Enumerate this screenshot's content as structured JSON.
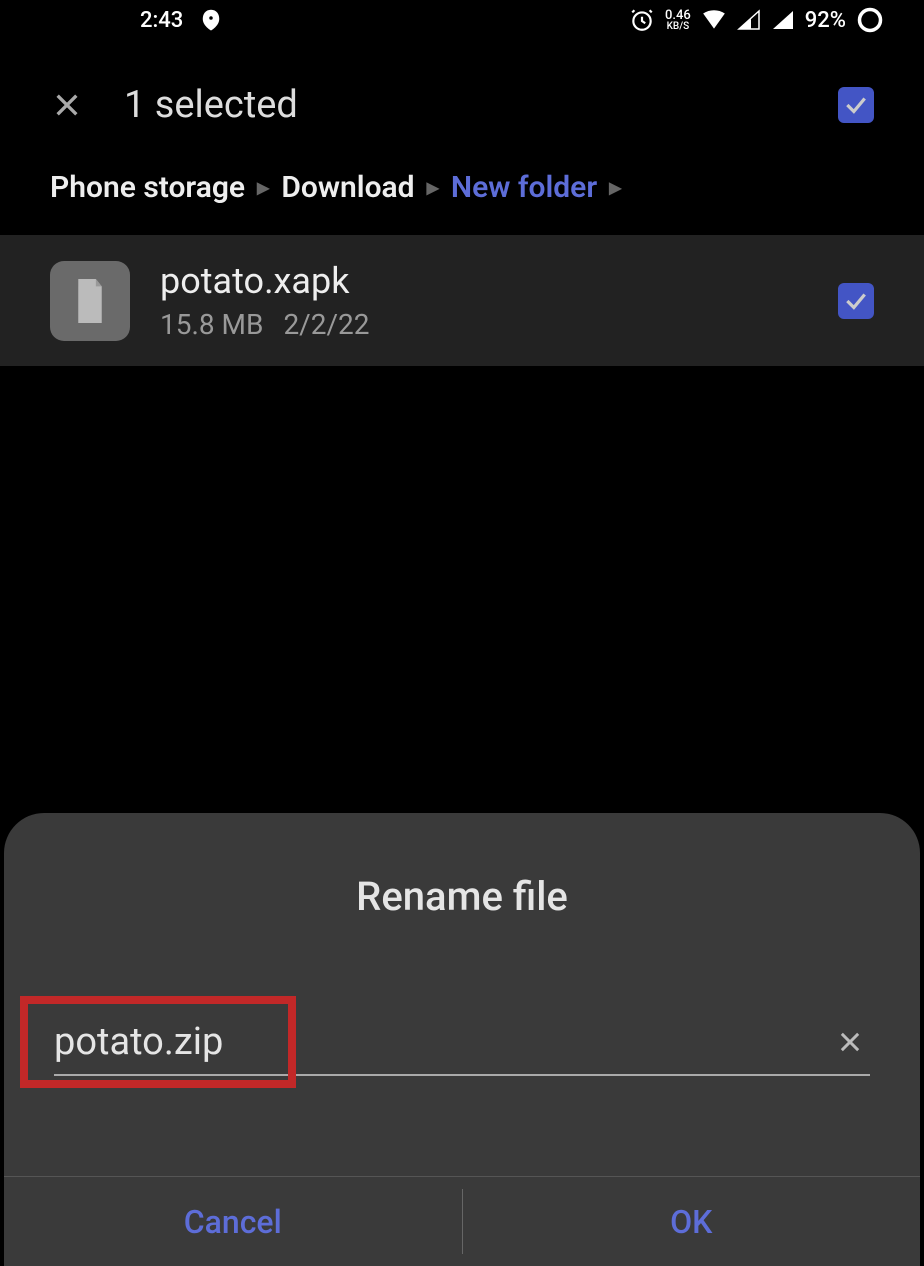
{
  "status": {
    "time": "2:43",
    "net_speed": "0.46",
    "net_unit": "KB/S",
    "battery": "92%"
  },
  "header": {
    "selected_text": "1 selected"
  },
  "breadcrumb": {
    "items": [
      "Phone storage",
      "Download",
      "New folder"
    ]
  },
  "file": {
    "name": "potato.xapk",
    "size": "15.8 MB",
    "date": "2/2/22"
  },
  "dialog": {
    "title": "Rename file",
    "input_value": "potato.zip",
    "cancel": "Cancel",
    "ok": "OK"
  }
}
